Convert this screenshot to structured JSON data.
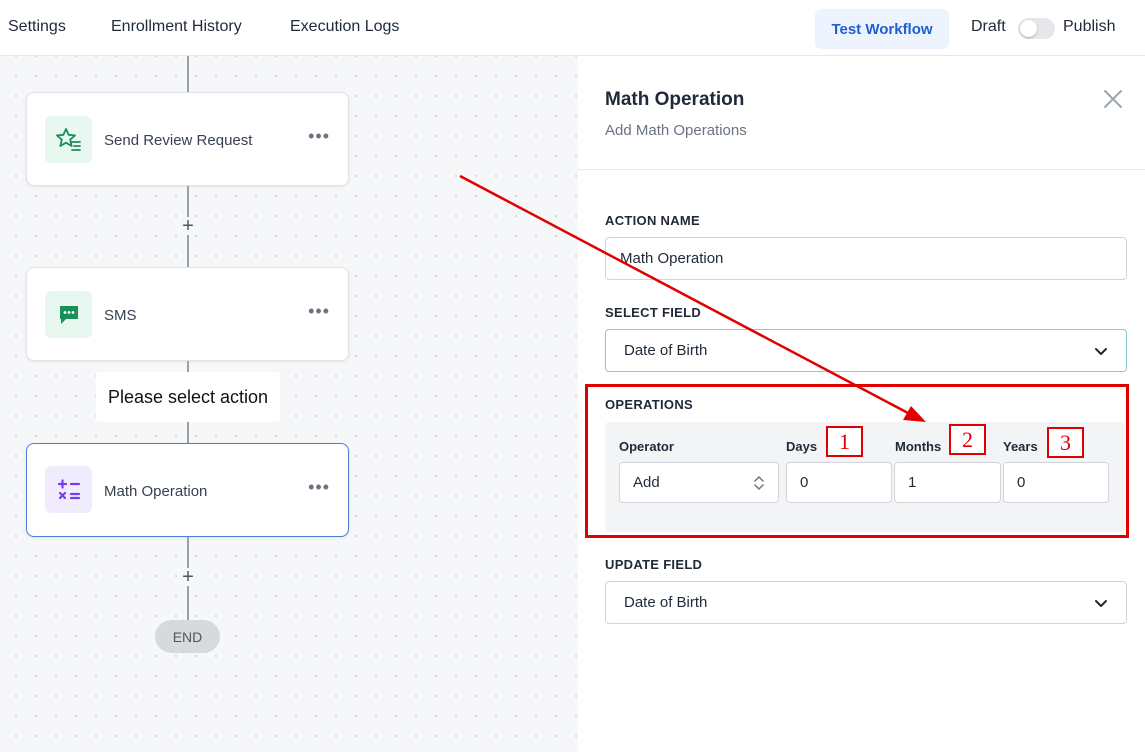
{
  "topbar": {
    "tabs": [
      "Settings",
      "Enrollment History",
      "Execution Logs"
    ],
    "test_button": "Test Workflow",
    "draft_label": "Draft",
    "publish_label": "Publish"
  },
  "canvas": {
    "nodes": [
      {
        "label": "Send Review Request",
        "icon": "star-list-icon",
        "menu": "•••"
      },
      {
        "label": "SMS",
        "icon": "chat-bubble-icon",
        "menu": "•••"
      },
      {
        "label": "Math Operation",
        "icon": "math-operators-icon",
        "menu": "•••"
      }
    ],
    "add_symbol": "+",
    "tooltip": "Please select action",
    "end_label": "END"
  },
  "panel": {
    "title": "Math Operation",
    "subtitle": "Add Math Operations",
    "action_name_label": "ACTION NAME",
    "action_name_value": "Math Operation",
    "select_field_label": "SELECT FIELD",
    "select_field_value": "Date of Birth",
    "operations_label": "OPERATIONS",
    "operations": {
      "operator_header": "Operator",
      "days_header": "Days",
      "months_header": "Months",
      "years_header": "Years",
      "operator_value": "Add",
      "days_value": "0",
      "months_value": "1",
      "years_value": "0"
    },
    "update_field_label": "UPDATE FIELD",
    "update_field_value": "Date of Birth"
  },
  "annotations": {
    "numbers": [
      "1",
      "2",
      "3"
    ],
    "color": "#e00000"
  },
  "colors": {
    "accent": "#1d5fd1",
    "selected_border": "#4a7fd6",
    "review_icon_bg": "#e8f7ef",
    "sms_icon_bg": "#e8f7ef",
    "math_icon_bg": "#f1ecfd"
  }
}
